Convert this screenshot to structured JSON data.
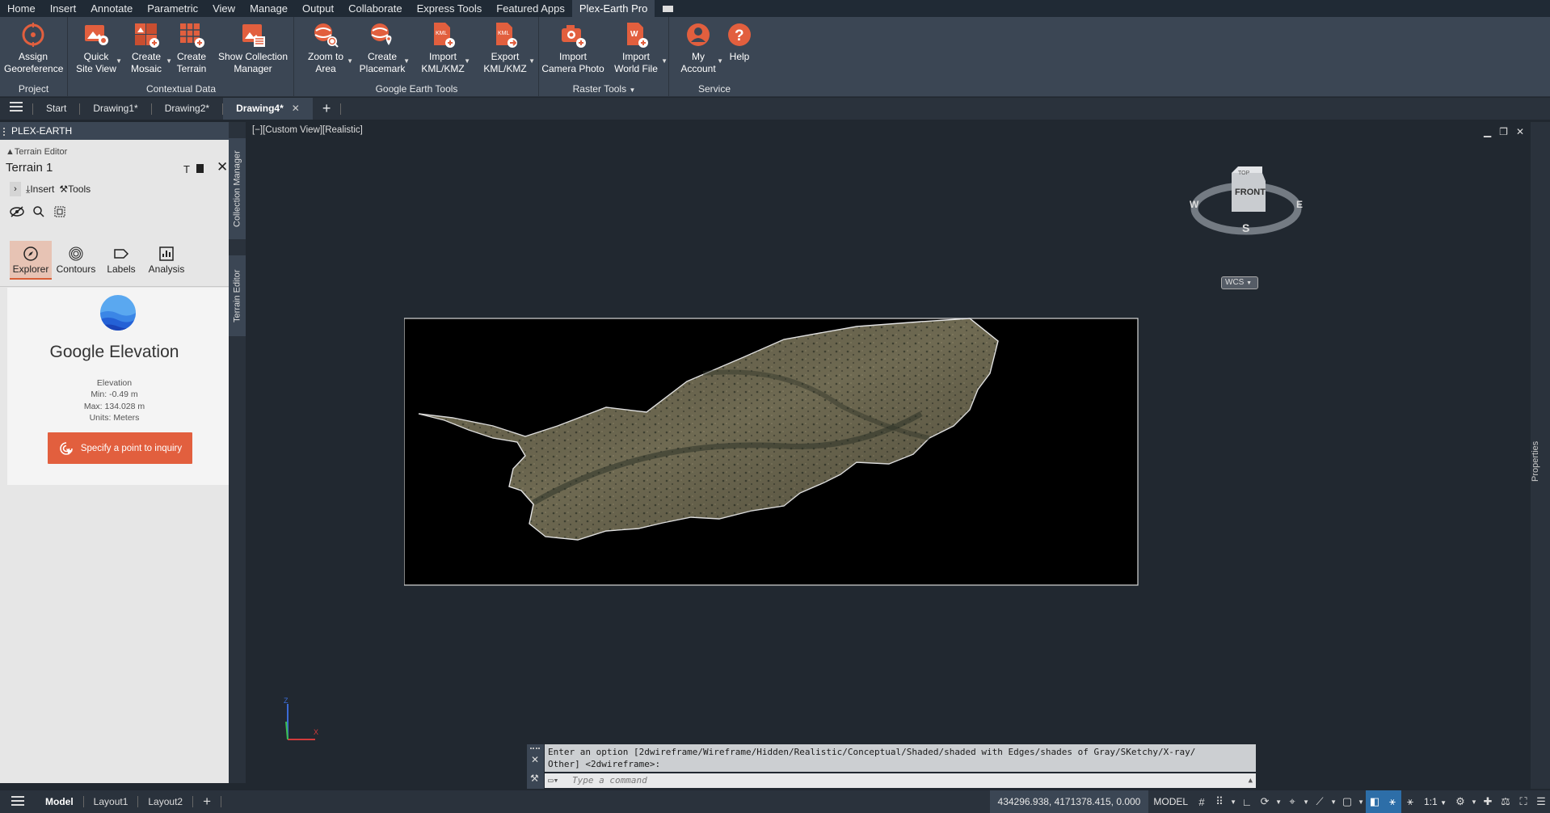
{
  "menu": {
    "items": [
      "Home",
      "Insert",
      "Annotate",
      "Parametric",
      "View",
      "Manage",
      "Output",
      "Collaborate",
      "Express Tools",
      "Featured Apps",
      "Plex-Earth Pro"
    ],
    "active": "Plex-Earth Pro"
  },
  "ribbon": {
    "panels": {
      "project": "Project",
      "contextual": "Contextual Data",
      "google": "Google Earth Tools",
      "raster": "Raster Tools",
      "service": "Service"
    },
    "buttons": {
      "assign": [
        "Assign",
        "Georeference"
      ],
      "quick": [
        "Quick",
        "Site View"
      ],
      "mosaic": [
        "Create",
        "Mosaic"
      ],
      "terrain": [
        "Create",
        "Terrain"
      ],
      "collection": [
        "Show Collection",
        "Manager"
      ],
      "zoom": [
        "Zoom to",
        "Area"
      ],
      "placemark": [
        "Create",
        "Placemark"
      ],
      "importkml": [
        "Import",
        "KML/KMZ"
      ],
      "exportkml": [
        "Export",
        "KML/KMZ"
      ],
      "camera": [
        "Import",
        "Camera Photo"
      ],
      "worldfile": [
        "Import",
        "World File"
      ],
      "account": [
        "My",
        "Account"
      ],
      "help": [
        "Help"
      ]
    },
    "accent_color": "#e25f3e"
  },
  "filetabs": {
    "start": "Start",
    "d1": "Drawing1*",
    "d2": "Drawing2*",
    "d4": "Drawing4*"
  },
  "palette": {
    "header": "PLEX-EARTH",
    "editor_label": "Terrain Editor",
    "terrain_name": "Terrain 1",
    "insert": "Insert",
    "tools": "Tools",
    "tabs": [
      "Explorer",
      "Contours",
      "Labels",
      "Analysis"
    ],
    "active_tab": "Explorer",
    "side_tabs": [
      "Collection Manager",
      "Terrain Editor"
    ],
    "card": {
      "title": "Google Elevation",
      "elevation": "Elevation",
      "min": "Min: -0.49 m",
      "max": "Max: 134.028 m",
      "units": "Units: Meters",
      "button": "Specify a point to inquiry"
    }
  },
  "viewport": {
    "label": "[−][Custom View][Realistic]",
    "viewcube": {
      "top": "TOP",
      "front": "FRONT",
      "w": "W",
      "e": "E",
      "s": "S",
      "wcs": "WCS"
    },
    "properties": "Properties"
  },
  "command": {
    "history_1": "Enter an option [2dwireframe/Wireframe/Hidden/Realistic/Conceptual/Shaded/shaded with Edges/shades of Gray/SKetchy/X-ray/",
    "history_2": "Other] <2dwireframe>:",
    "placeholder": "Type a command"
  },
  "status": {
    "layouts": [
      "Model",
      "Layout1",
      "Layout2"
    ],
    "coords": "434296.938, 4171378.415, 0.000",
    "model": "MODEL",
    "scale": "1:1"
  }
}
